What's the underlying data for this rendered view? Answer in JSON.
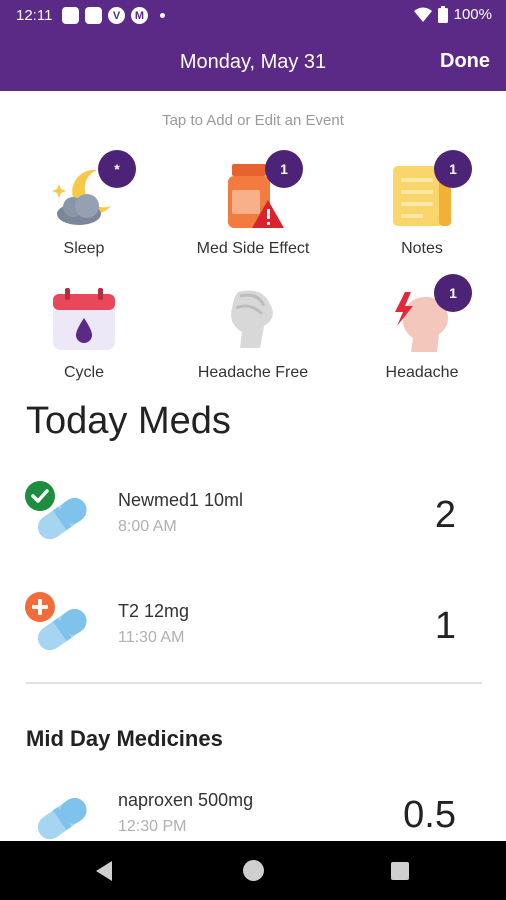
{
  "status_bar": {
    "time": "12:11",
    "app_icon_letters": [
      "V",
      "M"
    ],
    "battery": "100%",
    "colors": {
      "background": "#5b2a86"
    }
  },
  "header": {
    "title": "Monday, May 31",
    "done_label": "Done"
  },
  "events": {
    "hint": "Tap to Add or Edit an Event",
    "items": [
      {
        "label": "Sleep",
        "icon": "sleep-moon-cloud-icon",
        "badge": "*"
      },
      {
        "label": "Med Side Effect",
        "icon": "med-side-effect-bottle-icon",
        "badge": "1"
      },
      {
        "label": "Notes",
        "icon": "notes-icon",
        "badge": "1"
      },
      {
        "label": "Cycle",
        "icon": "cycle-calendar-icon",
        "badge": ""
      },
      {
        "label": "Headache Free",
        "icon": "headache-free-icon",
        "badge": ""
      },
      {
        "label": "Headache",
        "icon": "headache-icon",
        "badge": "1"
      }
    ]
  },
  "today_meds": {
    "title": "Today Meds",
    "items": [
      {
        "name": "Newmed1 10ml",
        "time": "8:00 AM",
        "quantity": "2",
        "status": "taken"
      },
      {
        "name": "T2 12mg",
        "time": "11:30 AM",
        "quantity": "1",
        "status": "add"
      }
    ]
  },
  "mid_day": {
    "title": "Mid Day Medicines",
    "items": [
      {
        "name": "naproxen 500mg",
        "time": "12:30 PM",
        "quantity": "0.5"
      }
    ]
  },
  "colors": {
    "brand_purple": "#5b2a86",
    "badge_purple": "#4d2378",
    "taken_green": "#1e8e3e",
    "add_orange": "#f26b3a",
    "pill_blue": "#8fc9ee"
  }
}
